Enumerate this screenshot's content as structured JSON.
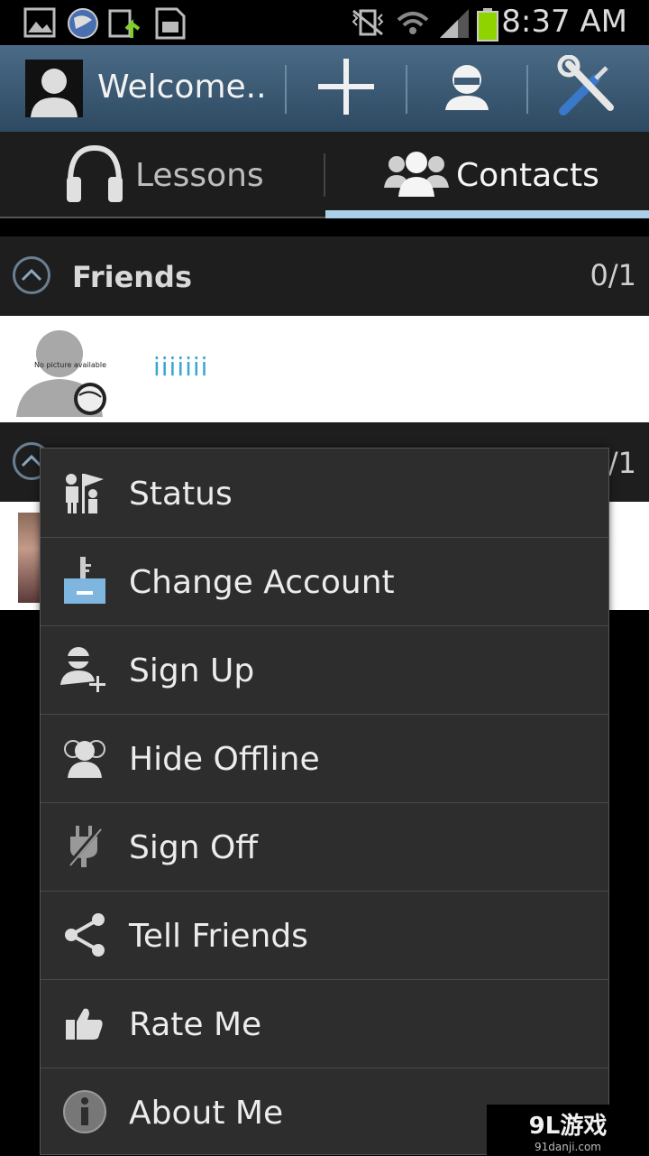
{
  "status_bar": {
    "time": "8:37 AM",
    "icons": [
      "image-icon",
      "globe-icon",
      "upload-icon",
      "sd-card-icon",
      "vibrate-icon",
      "wifi-icon",
      "signal-icon",
      "battery-icon"
    ],
    "battery_color": "#8fd400"
  },
  "action_bar": {
    "title": "Welcome..",
    "buttons": [
      "add-icon",
      "profile-icon",
      "settings-tools-icon"
    ]
  },
  "tabs": [
    {
      "label": "Lessons",
      "icon": "headphones-icon"
    },
    {
      "label": "Contacts",
      "icon": "contacts-group-icon",
      "selected": true
    }
  ],
  "groups": {
    "friends": {
      "title": "Friends",
      "count": "0/1"
    },
    "second": {
      "count_partial": "/1"
    }
  },
  "contacts": [
    {
      "name": "iiiiiii",
      "avatar_text": "No picture available"
    }
  ],
  "menu": {
    "items": [
      {
        "label": "Status",
        "icon": "status-flag-icon"
      },
      {
        "label": "Change Account",
        "icon": "change-account-icon"
      },
      {
        "label": "Sign Up",
        "icon": "add-user-icon"
      },
      {
        "label": "Hide Offline",
        "icon": "hide-offline-icon"
      },
      {
        "label": "Sign Off",
        "icon": "plug-off-icon"
      },
      {
        "label": "Tell Friends",
        "icon": "share-icon"
      },
      {
        "label": "Rate Me",
        "icon": "thumbs-up-icon"
      },
      {
        "label": "About Me",
        "icon": "info-icon"
      }
    ]
  },
  "watermark": {
    "main": "9L游戏",
    "sub": "91danji.com"
  },
  "colors": {
    "action_bar": "#3e5c77",
    "tab_indicator": "#aacfe6",
    "contact_name": "#3aa6d3",
    "menu_bg": "#2d2d2d"
  }
}
